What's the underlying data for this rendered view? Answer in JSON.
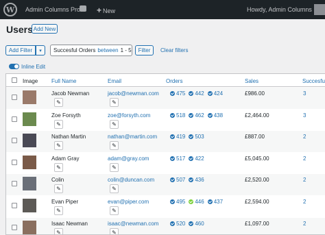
{
  "adminbar": {
    "site_name": "Admin Columns Pro",
    "new_label": "New",
    "howdy": "Howdy, Admin Columns"
  },
  "page": {
    "title": "Users",
    "add_new": "Add New"
  },
  "filters": {
    "add_filter": "Add Filter",
    "pill_field": "Succesful Orders",
    "pill_operator": "between",
    "pill_value": "1 - 5",
    "filter_button": "Filter",
    "clear_filters": "Clear filters"
  },
  "inline_edit": {
    "label": "Inline Edit",
    "enabled": true
  },
  "table": {
    "columns": [
      "Image",
      "Full Name",
      "Email",
      "Orders",
      "Sales",
      "Succesful"
    ],
    "rows": [
      {
        "name": "Jacob Newman",
        "email": "jacob@newman.com",
        "orders": [
          {
            "id": "475",
            "status": "blue"
          },
          {
            "id": "442",
            "status": "blue"
          },
          {
            "id": "424",
            "status": "blue"
          }
        ],
        "sales": "£986.00",
        "succ": "3"
      },
      {
        "name": "Zoe Forsyth",
        "email": "zoe@forsyth.com",
        "orders": [
          {
            "id": "518",
            "status": "blue"
          },
          {
            "id": "462",
            "status": "blue"
          },
          {
            "id": "438",
            "status": "blue"
          }
        ],
        "sales": "£2,464.00",
        "succ": "3"
      },
      {
        "name": "Nathan Martin",
        "email": "nathan@martin.com",
        "orders": [
          {
            "id": "419",
            "status": "blue"
          },
          {
            "id": "503",
            "status": "blue"
          }
        ],
        "sales": "£887.00",
        "succ": "2"
      },
      {
        "name": "Adam Gray",
        "email": "adam@gray.com",
        "orders": [
          {
            "id": "517",
            "status": "blue"
          },
          {
            "id": "422",
            "status": "blue"
          }
        ],
        "sales": "£5,045.00",
        "succ": "2"
      },
      {
        "name": "Colin",
        "email": "colin@duncan.com",
        "orders": [
          {
            "id": "507",
            "status": "blue"
          },
          {
            "id": "436",
            "status": "blue"
          }
        ],
        "sales": "£2,520.00",
        "succ": "2"
      },
      {
        "name": "Evan Piper",
        "email": "evan@piper.com",
        "orders": [
          {
            "id": "495",
            "status": "blue"
          },
          {
            "id": "446",
            "status": "green"
          },
          {
            "id": "437",
            "status": "blue"
          }
        ],
        "sales": "£2,594.00",
        "succ": "2"
      },
      {
        "name": "Isaac Newman",
        "email": "isaac@newman.com",
        "orders": [
          {
            "id": "520",
            "status": "blue"
          },
          {
            "id": "460",
            "status": "blue"
          }
        ],
        "sales": "£1,097.00",
        "succ": "2"
      }
    ]
  },
  "colors": {
    "accent": "#2271b1",
    "order_blue": "#2271b1",
    "order_green": "#7ad03a",
    "adminbar": "#1d2327"
  },
  "icons": {
    "wp_logo": "wordpress-icon",
    "comments": "comment-icon",
    "edit": "pencil-icon",
    "order_status": "check-circle-icon"
  }
}
